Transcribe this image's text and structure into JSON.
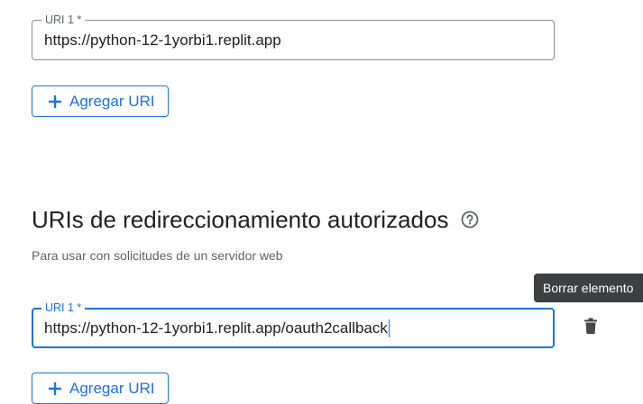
{
  "top_section": {
    "field_label": "URI 1 *",
    "field_value": "https://python-12-1yorbi1.replit.app",
    "add_button_label": "Agregar URI"
  },
  "redirect_section": {
    "title": "URIs de redireccionamiento autorizados",
    "subtitle": "Para usar con solicitudes de un servidor web",
    "field_label": "URI 1 *",
    "field_value": "https://python-12-1yorbi1.replit.app/oauth2callback",
    "tooltip": "Borrar elemento",
    "add_button_label": "Agregar URI"
  },
  "colors": {
    "accent": "#1a73e8",
    "tooltip_bg": "#3c4043",
    "icon": "#444746"
  },
  "icons": [
    "plus-icon",
    "help-circle-icon",
    "trash-icon"
  ]
}
